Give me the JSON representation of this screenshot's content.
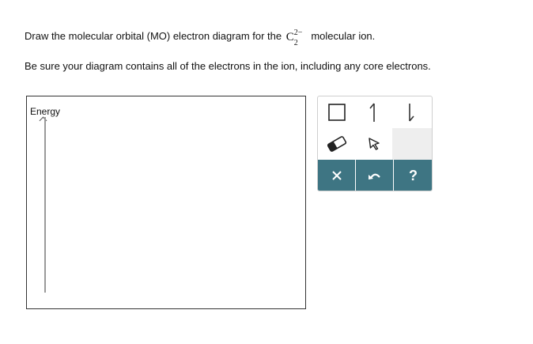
{
  "prompt": {
    "before": "Draw the molecular orbital (MO) electron diagram for the ",
    "formula": {
      "element": "C",
      "subscript": "2",
      "superscript": "2−"
    },
    "after": " molecular ion."
  },
  "note": "Be sure your diagram contains all of the electrons in the ion, including any core electrons.",
  "canvas": {
    "axis_label": "Energy"
  },
  "toolbar": {
    "tools": [
      {
        "name": "orbital-box-tool",
        "icon": "square-outline-icon"
      },
      {
        "name": "spin-up-electron-tool",
        "icon": "half-arrow-up-icon"
      },
      {
        "name": "spin-down-electron-tool",
        "icon": "half-arrow-down-icon"
      },
      {
        "name": "eraser-tool",
        "icon": "eraser-icon"
      },
      {
        "name": "select-pointer-tool",
        "icon": "cursor-arrow-icon"
      }
    ],
    "actions": [
      {
        "name": "clear-button",
        "icon": "x-icon"
      },
      {
        "name": "undo-button",
        "icon": "undo-arrow-icon"
      },
      {
        "name": "help-button",
        "icon": "question-mark-icon",
        "label": "?"
      }
    ],
    "colors": {
      "action_bar": "#3e7583",
      "disabled_cell": "#eeeeee",
      "border": "#cfcfcf"
    }
  }
}
